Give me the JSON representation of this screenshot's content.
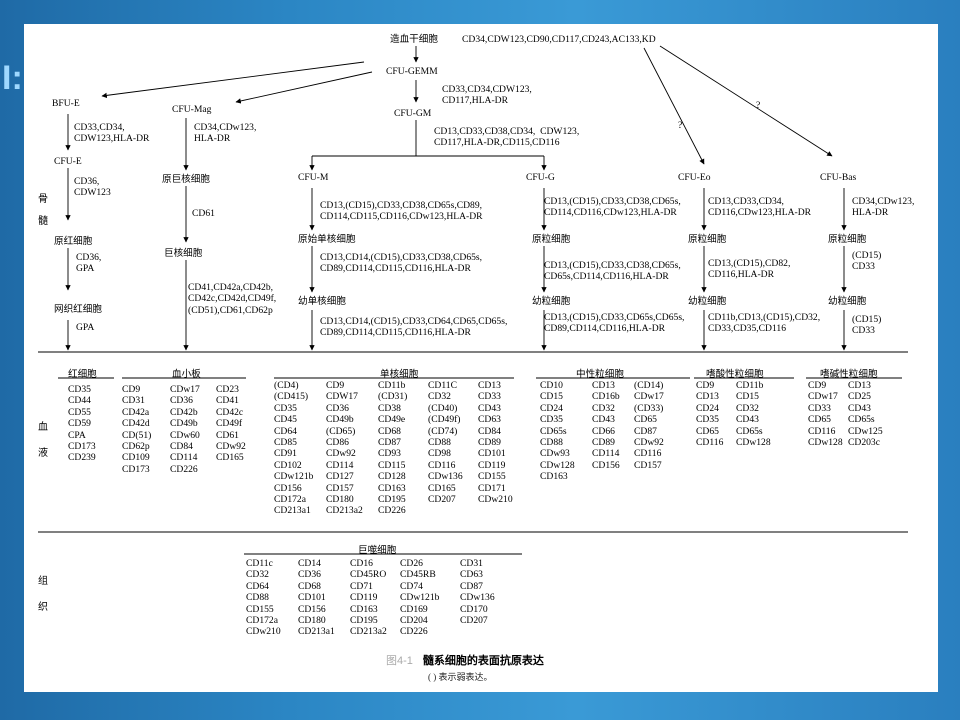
{
  "slide_title": "I:",
  "tree": {
    "root": {
      "label": "造血干细胞",
      "markers": "CD34,CDW123,CD90,CD117,CD243,AC133,KD"
    },
    "gemm": {
      "label": "CFU-GEMM",
      "markers": "CD33,CD34,CDW123,\nCD117,HLA-DR"
    },
    "gm": {
      "label": "CFU-GM",
      "markers": "CD13,CD33,CD38,CD34,  CDW123,\nCD117,HLA-DR,CD115,CD116"
    },
    "bfue": {
      "label": "BFU-E",
      "markers": "CD33,CD34,\nCDW123,HLA-DR"
    },
    "cfue": {
      "label": "CFU-E",
      "markers": "CD36,\nCDW123"
    },
    "proery": {
      "label": "原红细胞",
      "markers": "CD36,\nGPA"
    },
    "retic": {
      "label": "网织红细胞",
      "markers": "GPA"
    },
    "mag": {
      "label": "CFU-Mag",
      "markers": "CD34,CDw123,\nHLA-DR"
    },
    "promeg": {
      "label": "原巨核细胞",
      "markers": "CD61"
    },
    "meg": {
      "label": "巨核细胞",
      "markers": "CD41,CD42a,CD42b,\nCD42c,CD42d,CD49f,\n(CD51),CD61,CD62p"
    },
    "cfum": {
      "label": "CFU-M",
      "markers": "CD13,(CD15),CD33,CD38,CD65s,CD89,\nCD114,CD115,CD116,CDw123,HLA-DR"
    },
    "promono": {
      "label": "原始单核细胞",
      "markers": "CD13,CD14,(CD15),CD33,CD38,CD65s,\nCD89,CD114,CD115,CD116,HLA-DR"
    },
    "immono": {
      "label": "幼单核细胞",
      "markers": "CD13,CD14,(CD15),CD33,CD64,CD65,CD65s,\nCD89,CD114,CD115,CD116,HLA-DR"
    },
    "cfug": {
      "label": "CFU-G",
      "markers": "CD13,(CD15),CD33,CD38,CD65s,\nCD114,CD116,CDw123,HLA-DR"
    },
    "myeloblast": {
      "label": "原粒细胞",
      "markers": "CD13,(CD15),CD33,CD38,CD65s,\nCD65s,CD114,CD116,HLA-DR"
    },
    "promyelo": {
      "label": "幼粒细胞",
      "markers": "CD13,(CD15),CD33,CD65s,CD65s,\nCD89,CD114,CD116,HLA-DR"
    },
    "cfueo": {
      "label": "CFU-Eo",
      "markers": "CD13,CD33,CD34,\nCD116,CDw123,HLA-DR"
    },
    "eoblast": {
      "label": "原粒细胞",
      "markers": "CD13,(CD15),CD82,\nCD116,HLA-DR"
    },
    "eoyoung": {
      "label": "幼粒细胞",
      "markers": "CD11b,CD13,(CD15),CD32,\nCD33,CD35,CD116"
    },
    "cfubas": {
      "label": "CFU-Bas",
      "markers": "CD34,CDw123,\nHLA-DR"
    },
    "basblast": {
      "label": "原粒细胞",
      "markers": "(CD15)\nCD33"
    },
    "basyoung": {
      "label": "幼粒细胞",
      "markers": "(CD15)\nCD33"
    },
    "q1": "?",
    "q2": "?"
  },
  "side_labels": {
    "bone_marrow": [
      "骨",
      "髓"
    ],
    "blood": [
      "血",
      "液"
    ],
    "tissue": [
      "组",
      "织"
    ]
  },
  "blood_sections": [
    {
      "title": "红细胞",
      "columns": [
        [
          "CD35",
          "CD44",
          "CD55",
          "CD59",
          "CPA",
          "CD173",
          "CD239"
        ]
      ]
    },
    {
      "title": "血小板",
      "columns": [
        [
          "CD9",
          "CD31",
          "CD42a",
          "CD42d",
          "CD(51)",
          "CD62p",
          "CD109",
          "CD173"
        ],
        [
          "CDw17",
          "CD36",
          "CD42b",
          "CD49b",
          "CDw60",
          "CD84",
          "CD114",
          "CD226"
        ],
        [
          "CD23",
          "CD41",
          "CD42c",
          "CD49f",
          "CD61",
          "CDw92",
          "CD165"
        ]
      ]
    },
    {
      "title": "单核细胞",
      "columns": [
        [
          "(CD4)",
          "(CD415)",
          "CD35",
          "CD45",
          "CD64",
          "CD85",
          "CD91",
          "CD102",
          "CDw121b",
          "CD156",
          "CD172a",
          "CD213a1"
        ],
        [
          "CD9",
          "CDW17",
          "CD36",
          "CD49b",
          "(CD65)",
          "CD86",
          "CDw92",
          "CD114",
          "CD127",
          "CD157",
          "CD180",
          "CD213a2"
        ],
        [
          "CD11b",
          "(CD31)",
          "CD38",
          "CD49e",
          "CD68",
          "CD87",
          "CD93",
          "CD115",
          "CD128",
          "CD163",
          "CD195",
          "CD226"
        ],
        [
          "CD11C",
          "CD32",
          "(CD40)",
          "(CD49f)",
          "(CD74)",
          "CD88",
          "CD98",
          "CD116",
          "CDw136",
          "CD165",
          "CD207"
        ],
        [
          "CD13",
          "CD33",
          "CD43",
          "CD63",
          "CD84",
          "CD89",
          "CD101",
          "CD119",
          "CD155",
          "CD171",
          "CDw210"
        ]
      ]
    },
    {
      "title": "中性粒细胞",
      "columns": [
        [
          "CD10",
          "CD15",
          "CD24",
          "CD35",
          "CD65s",
          "CD88",
          "CDw93",
          "CDw128",
          "CD163"
        ],
        [
          "CD13",
          "CD16b",
          "CD32",
          "CD43",
          "CD66",
          "CD89",
          "CD114",
          "CD156"
        ],
        [
          "(CD14)",
          "CDw17",
          "(CD33)",
          "CD65",
          "CD87",
          "CDw92",
          "CD116",
          "CD157"
        ]
      ]
    },
    {
      "title": "嗜酸性粒细胞",
      "columns": [
        [
          "CD9",
          "CD13",
          "CD24",
          "CD35",
          "CD65",
          "CD116"
        ],
        [
          "CD11b",
          "CD15",
          "CD32",
          "CD43",
          "CD65s",
          "CDw128"
        ]
      ]
    },
    {
      "title": "嗜碱性粒细胞",
      "columns": [
        [
          "CD9",
          "CDw17",
          "CD33",
          "CD65",
          "CD116",
          "CDw128"
        ],
        [
          "CD13",
          "CD25",
          "CD43",
          "CD65s",
          "CDw125",
          "CD203c"
        ]
      ]
    }
  ],
  "tissue_section": {
    "title": "巨噬细胞",
    "columns": [
      [
        "CD11c",
        "CD32",
        "CD64",
        "CD88",
        "CD155",
        "CD172a",
        "CDw210"
      ],
      [
        "CD14",
        "CD36",
        "CD68",
        "CD101",
        "CD156",
        "CD180",
        "CD213a1"
      ],
      [
        "CD16",
        "CD45RO",
        "CD71",
        "CD119",
        "CD163",
        "CD195",
        "CD213a2"
      ],
      [
        "CD26",
        "CD45RB",
        "CD74",
        "CDw121b",
        "CD169",
        "CD204",
        "CD226"
      ],
      [
        "CD31",
        "CD63",
        "CD87",
        "CDw136",
        "CD170",
        "CD207"
      ]
    ]
  },
  "caption": {
    "faded": "图4-1",
    "title": "髓系细胞的表面抗原表达",
    "note": "( ) 表示弱表达。"
  }
}
